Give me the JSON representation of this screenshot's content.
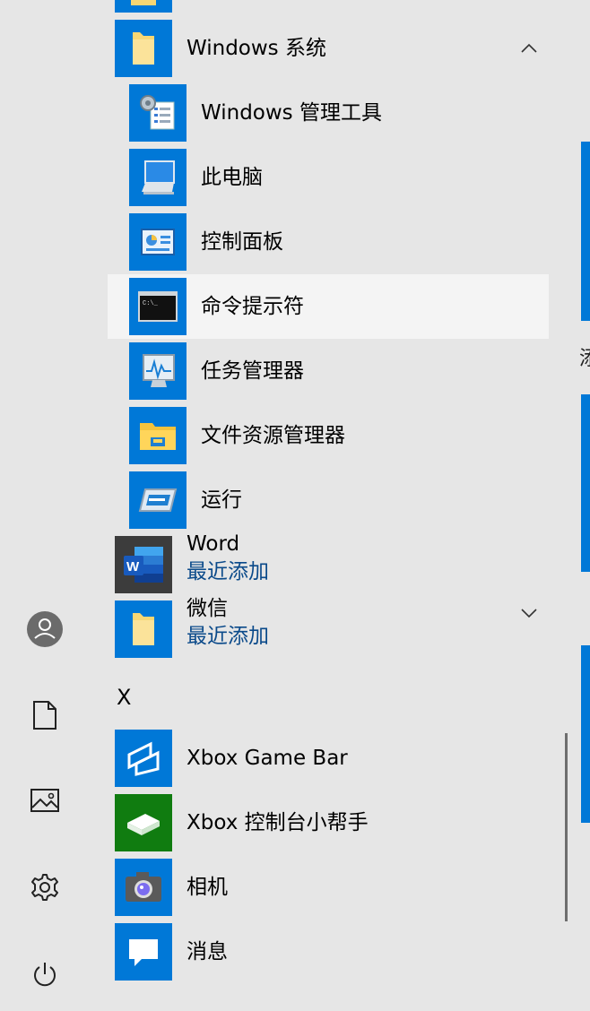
{
  "rail": {
    "items": [
      {
        "icon": "user-avatar-icon"
      },
      {
        "icon": "document-icon"
      },
      {
        "icon": "pictures-icon"
      },
      {
        "icon": "settings-gear-icon"
      },
      {
        "icon": "power-icon"
      }
    ]
  },
  "list": {
    "groups": [
      {
        "label": "Windows 系统",
        "expanded": true,
        "icon": "folder-icon",
        "color": "#0078d7"
      },
      {
        "label": "Word",
        "sublabel": "最近添加",
        "icon": "word-icon",
        "color": "#3c3c3c"
      },
      {
        "label": "微信",
        "sublabel": "最近添加",
        "icon": "folder-icon",
        "color": "#0078d7"
      }
    ],
    "windows_items": [
      {
        "label": "Windows 管理工具",
        "icon": "admin-tools-icon"
      },
      {
        "label": "此电脑",
        "icon": "this-pc-icon"
      },
      {
        "label": "控制面板",
        "icon": "control-panel-icon"
      },
      {
        "label": "命令提示符",
        "icon": "command-prompt-icon",
        "highlighted": true
      },
      {
        "label": "任务管理器",
        "icon": "task-manager-icon"
      },
      {
        "label": "文件资源管理器",
        "icon": "file-explorer-icon"
      },
      {
        "label": "运行",
        "icon": "run-icon"
      }
    ],
    "section_letter": "X",
    "x_items": [
      {
        "label": "Xbox Game Bar",
        "icon": "xbox-game-bar-icon",
        "color": "#0078d7"
      },
      {
        "label": "Xbox 控制台小帮手",
        "icon": "xbox-console-icon",
        "color": "#107c10"
      },
      {
        "label": "相机",
        "icon": "camera-icon",
        "color": "#0078d7"
      },
      {
        "label": "消息",
        "icon": "messaging-icon",
        "color": "#0078d7"
      }
    ]
  },
  "edge_text": "添",
  "colors": {
    "accent": "#0078d7",
    "xbox_green": "#107c10",
    "link": "#0b4a8a",
    "highlight": "#f4f4f4",
    "background": "#e6e6e6"
  }
}
